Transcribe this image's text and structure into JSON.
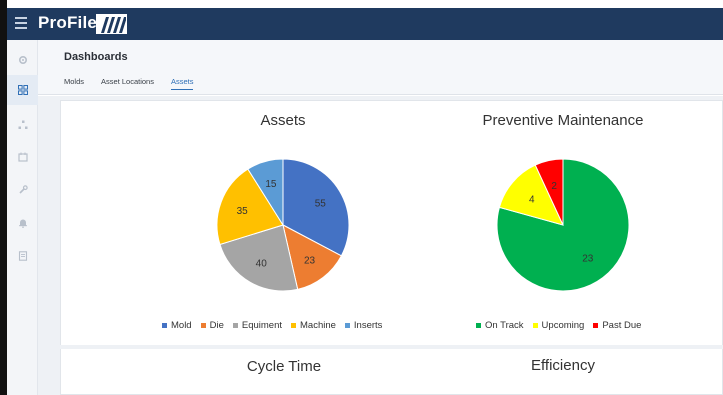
{
  "app": {
    "brand": "ProFile"
  },
  "header": {
    "title": "Dashboards",
    "tabs": [
      {
        "label": "Molds",
        "active": false
      },
      {
        "label": "Asset Locations",
        "active": false
      },
      {
        "label": "Assets",
        "active": true
      }
    ]
  },
  "sidebar": {
    "items": [
      {
        "icon": "gear-icon",
        "active": false
      },
      {
        "icon": "dashboard-grid-icon",
        "active": true
      },
      {
        "icon": "hierarchy-icon",
        "active": false
      },
      {
        "icon": "calendar-icon",
        "active": false
      },
      {
        "icon": "wrench-icon",
        "active": false
      },
      {
        "icon": "bell-icon",
        "active": false
      },
      {
        "icon": "report-icon",
        "active": false
      }
    ]
  },
  "colors": {
    "topbar": "#1f3a5f",
    "accent": "#2f6fb6"
  },
  "chart_data": [
    {
      "type": "pie",
      "title": "Assets",
      "categories": [
        "Mold",
        "Die",
        "Equiment",
        "Machine",
        "Inserts"
      ],
      "values": [
        55,
        23,
        40,
        35,
        15
      ],
      "colors": [
        "#4472c4",
        "#ed7d31",
        "#a5a5a5",
        "#ffc000",
        "#5b9bd5"
      ],
      "legend": "bottom"
    },
    {
      "type": "pie",
      "title": "Preventive Maintenance",
      "categories": [
        "On Track",
        "Upcoming",
        "Past Due"
      ],
      "values": [
        23,
        4,
        2
      ],
      "colors": [
        "#00b050",
        "#ffff00",
        "#ff0000"
      ],
      "legend": "bottom"
    }
  ],
  "lower_panels": {
    "cycle_time_title": "Cycle Time",
    "efficiency_title": "Efficiency"
  }
}
